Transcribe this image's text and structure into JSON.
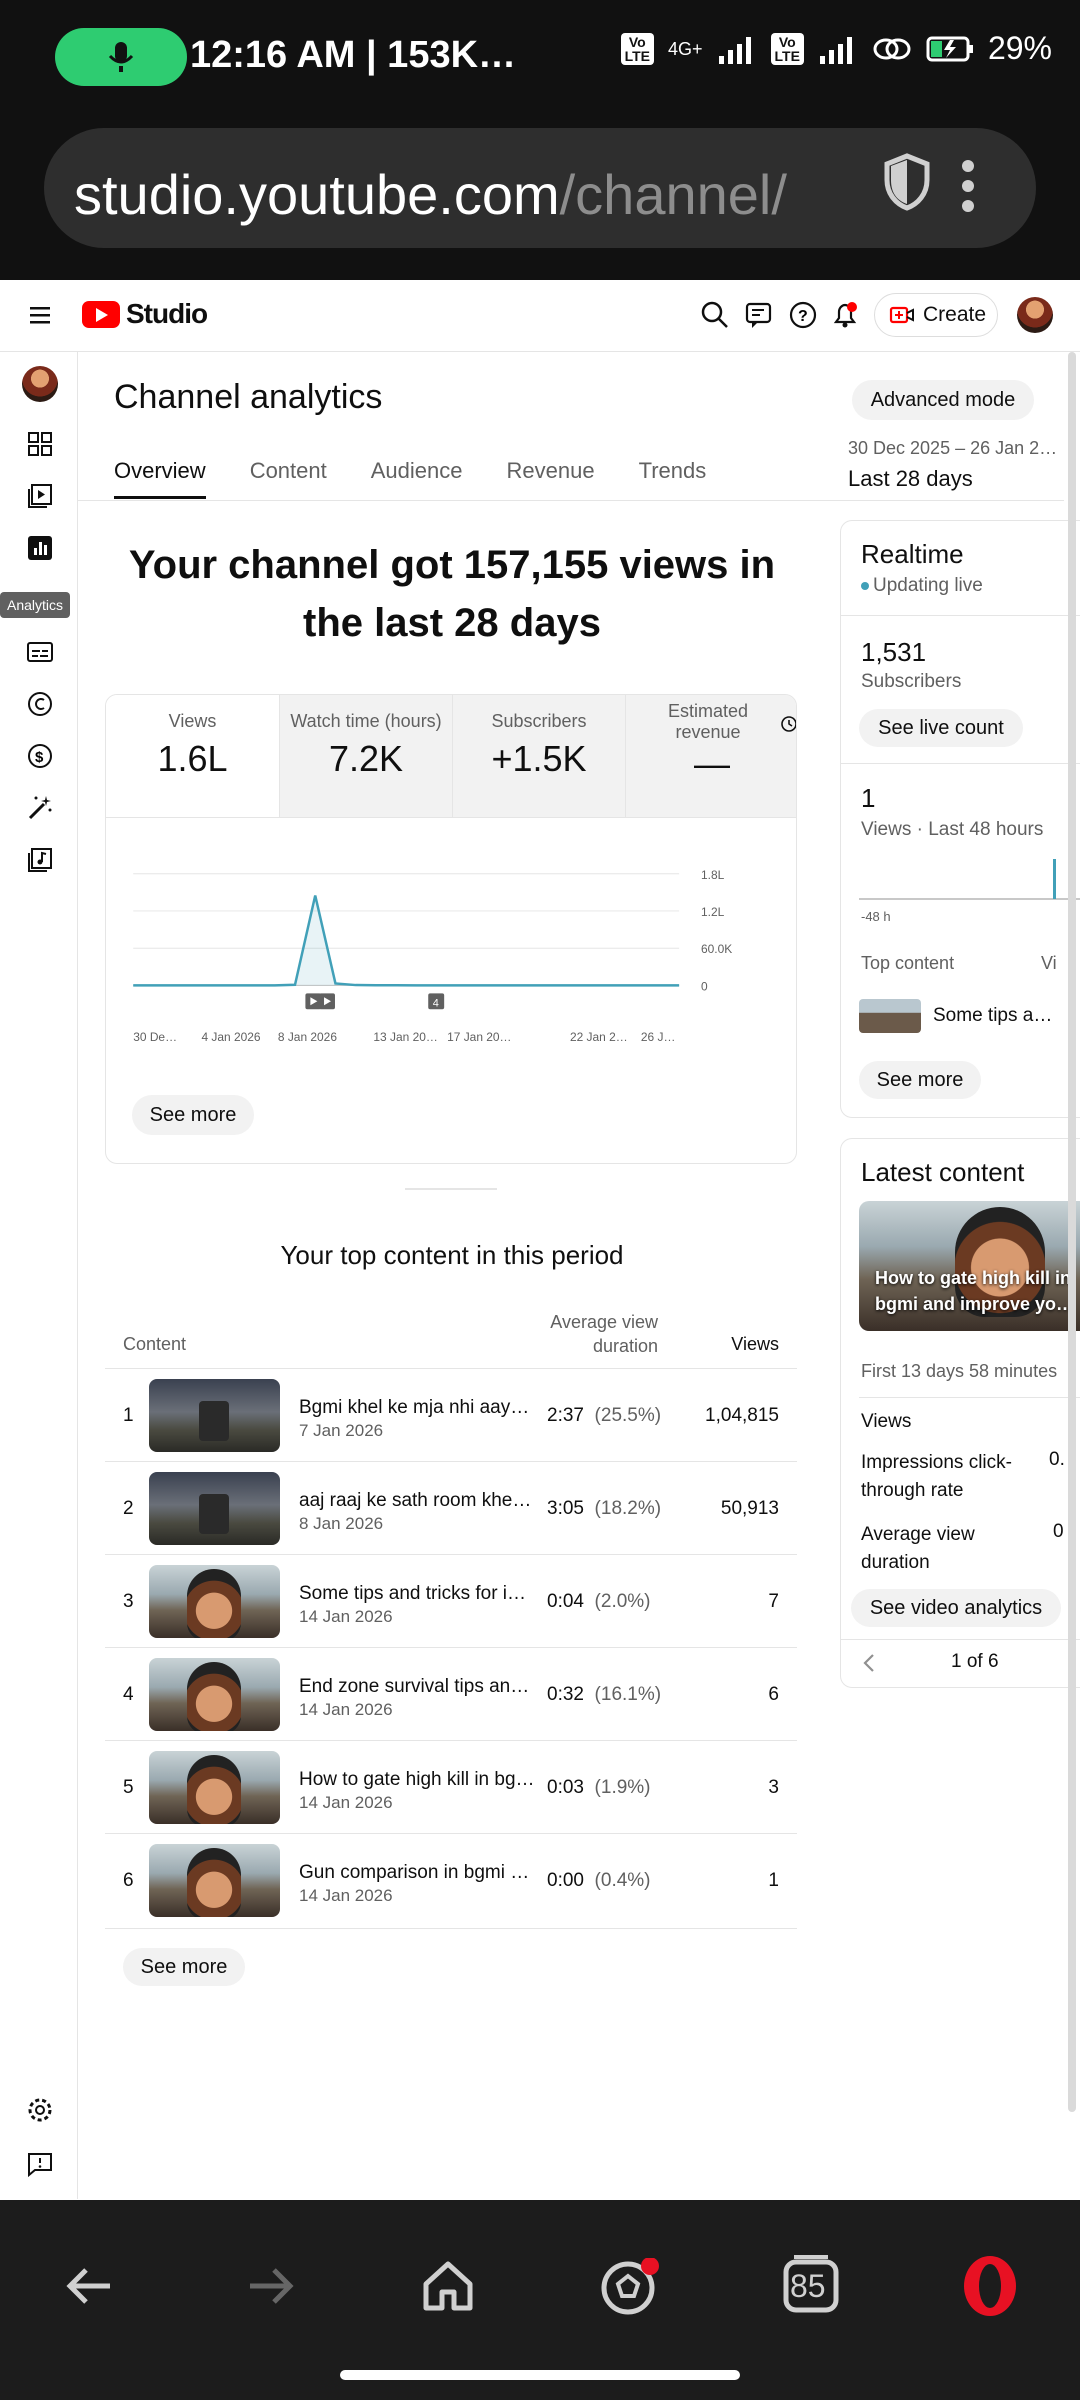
{
  "status_bar": {
    "time": "12:16 AM | 153K…",
    "network": "4G+",
    "lte_label": "Vo\nLTE",
    "battery": "29%"
  },
  "browser": {
    "url_host": "studio.youtube.com",
    "url_path": "/channel/",
    "icons": [
      "shield-icon",
      "more-vert-icon"
    ]
  },
  "header": {
    "logo_text": "Studio",
    "create_label": "Create",
    "icons": [
      "menu-icon",
      "search-icon",
      "comments-icon",
      "help-icon",
      "bell-icon"
    ]
  },
  "left_rail": {
    "tooltip": "Analytics",
    "icons": [
      "dashboard-icon",
      "content-icon",
      "analytics-icon",
      "subtitles-icon",
      "copyright-icon",
      "earn-icon",
      "customization-icon",
      "audio-library-icon",
      "settings-icon",
      "feedback-icon"
    ]
  },
  "page": {
    "title": "Channel analytics",
    "advanced_mode": "Advanced mode",
    "tabs": [
      "Overview",
      "Content",
      "Audience",
      "Revenue",
      "Trends"
    ],
    "active_tab": "Overview",
    "date_range": "30 Dec 2025 – 26 Jan 2…",
    "date_label": "Last 28 days",
    "headline": "Your channel got 157,155 views in the last 28 days"
  },
  "metrics": [
    {
      "label": "Views",
      "value": "1.6L"
    },
    {
      "label": "Watch time (hours)",
      "value": "7.2K"
    },
    {
      "label": "Subscribers",
      "value": "+1.5K"
    },
    {
      "label": "Estimated revenue",
      "value": "—"
    }
  ],
  "chart_data": {
    "type": "line",
    "x": [
      "30 De…",
      "4 Jan 2026",
      "8 Jan 2026",
      "13 Jan 20…",
      "17 Jan 20…",
      "22 Jan 2…",
      "26 J…"
    ],
    "y_ticks": [
      "1.8L",
      "1.2L",
      "60.0K",
      "0"
    ],
    "series": [
      {
        "values": [
          0,
          0,
          0,
          0,
          0,
          0,
          0,
          0,
          1000,
          145000,
          3000,
          500,
          200,
          100,
          50,
          40,
          30,
          20,
          10,
          10,
          10,
          10,
          5,
          5,
          5,
          5,
          5,
          5
        ]
      }
    ],
    "markers": [
      "video",
      "video",
      "4"
    ],
    "color": "#41a0b8",
    "ylim": [
      0,
      180000
    ]
  },
  "see_more_label": "See more",
  "top_content": {
    "title": "Your top content in this period",
    "headers": {
      "content": "Content",
      "duration": "Average view duration",
      "views": "Views"
    },
    "rows": [
      {
        "idx": "1",
        "title": "Bgmi khel ke mja nhi aaya …",
        "date": "7 Jan 2026",
        "duration": "2:37",
        "pct": "(25.5%)",
        "views": "1,04,815",
        "thumb": "game"
      },
      {
        "idx": "2",
        "title": "aaj raaj ke sath room khel …",
        "date": "8 Jan 2026",
        "duration": "3:05",
        "pct": "(18.2%)",
        "views": "50,913",
        "thumb": "game"
      },
      {
        "idx": "3",
        "title": "Some tips and tricks for i…",
        "date": "14 Jan 2026",
        "duration": "0:04",
        "pct": "(2.0%)",
        "views": "7",
        "thumb": "face"
      },
      {
        "idx": "4",
        "title": "End zone survival tips and …",
        "date": "14 Jan 2026",
        "duration": "0:32",
        "pct": "(16.1%)",
        "views": "6",
        "thumb": "face"
      },
      {
        "idx": "5",
        "title": "How to gate high kill in bg…",
        "date": "14 Jan 2026",
        "duration": "0:03",
        "pct": "(1.9%)",
        "views": "3",
        "thumb": "face"
      },
      {
        "idx": "6",
        "title": "Gun comparison in bgmi …",
        "date": "14 Jan 2026",
        "duration": "0:00",
        "pct": "(0.4%)",
        "views": "1",
        "thumb": "face"
      }
    ]
  },
  "realtime": {
    "title": "Realtime",
    "status": "Updating live",
    "subs_value": "1,531",
    "subs_label": "Subscribers",
    "live_count_btn": "See live count",
    "views_value": "1",
    "views_label": "Views · Last 48 hours",
    "axis_label": "-48 h",
    "top_content_label": "Top content",
    "views_col": "Vi",
    "top_item": "Some tips a…"
  },
  "latest": {
    "title": "Latest content",
    "thumb_text": "How to gate high kill in bgmi and improve yo…",
    "first_period": "First 13 days 58 minutes",
    "metrics": [
      {
        "label": "Views",
        "value": ""
      },
      {
        "label": "Impressions click-through rate",
        "value": "0."
      },
      {
        "label": "Average view duration",
        "value": "0"
      }
    ],
    "analytics_btn": "See video analytics",
    "pager": "1 of 6"
  },
  "bottom_nav": {
    "speed_dial_number": "85",
    "icons": [
      "back-icon",
      "forward-icon",
      "home-icon",
      "football-icon",
      "speed-dial-icon",
      "opera-icon"
    ]
  }
}
